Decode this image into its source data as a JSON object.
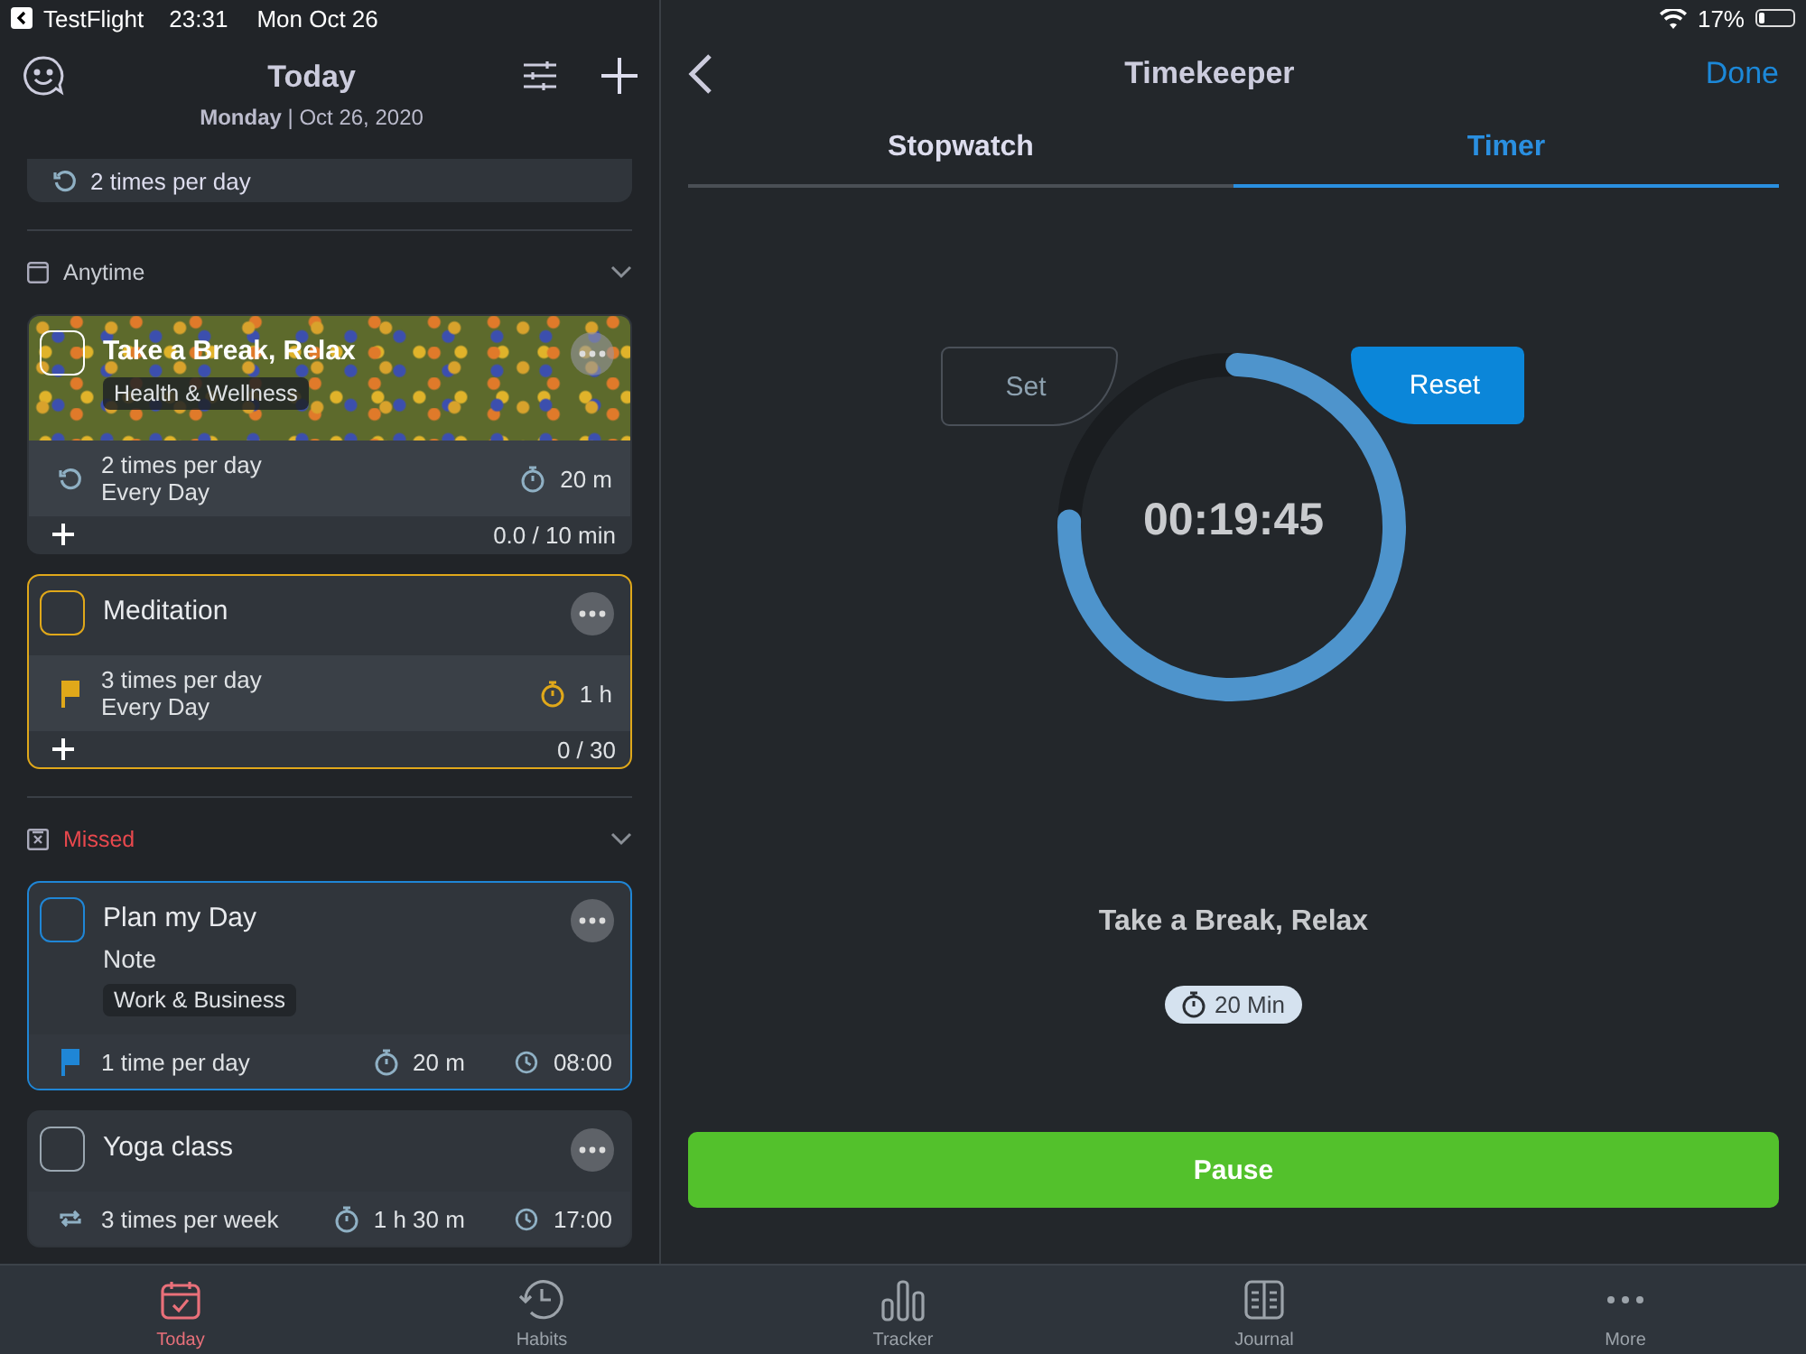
{
  "status_bar": {
    "back_app": "TestFlight",
    "time": "23:31",
    "date": "Mon Oct 26",
    "battery": "17%"
  },
  "today": {
    "title": "Today",
    "subtitle": "**Monday** | Oct 26, 2020",
    "partial_card": {
      "schedule": {
        "kind": "repeat",
        "frequency": "2 times per day"
      }
    },
    "sections": [
      {
        "kind": "anytime",
        "label": "Anytime",
        "expanded": true,
        "cards": [
          {
            "kind": "photo",
            "name": "Take a Break, Relax",
            "checked": false,
            "tag": "Health & Wellness",
            "schedule": {
              "kind": "repeat",
              "frequency": "2 times per day",
              "days": "Every Day"
            },
            "duration": "20 m",
            "progress": "0.0 / 10 min"
          },
          {
            "kind": "plain",
            "name": "Meditation",
            "checked": false,
            "color": "#e0a81a",
            "schedule": {
              "kind": "flag",
              "frequency": "3 times per day",
              "days": "Every Day"
            },
            "duration": "1 h",
            "progress": "0 / 30"
          }
        ]
      },
      {
        "kind": "missed",
        "label": "Missed",
        "expanded": true,
        "cards": [
          {
            "kind": "plain",
            "name": "Plan my Day",
            "checked": false,
            "color": "#1f86d6",
            "note": "Note",
            "tag": "Work & Business",
            "schedule": {
              "kind": "flag",
              "frequency": "1 time per day"
            },
            "duration": "20 m",
            "time": "08:00"
          },
          {
            "kind": "plain",
            "name": "Yoga class",
            "checked": false,
            "schedule": {
              "kind": "loop",
              "frequency": "3 times per week"
            },
            "duration": "1 h 30 m",
            "time": "17:00"
          }
        ]
      }
    ]
  },
  "timekeeper": {
    "title": "Timekeeper",
    "done": "Done",
    "tabs": [
      {
        "label": "Stopwatch",
        "selected": false
      },
      {
        "label": "Timer",
        "selected": true
      }
    ],
    "set": "Set",
    "reset": "Reset",
    "time": "00:19:45",
    "level": 0.75,
    "task": "Take a Break, Relax",
    "duration": "20 Min",
    "pause": "Pause"
  },
  "tab_bar": [
    {
      "label": "Today",
      "selected": true
    },
    {
      "label": "Habits",
      "selected": false
    },
    {
      "label": "Tracker",
      "selected": false
    },
    {
      "label": "Journal",
      "selected": false
    },
    {
      "label": "More",
      "selected": false
    }
  ]
}
